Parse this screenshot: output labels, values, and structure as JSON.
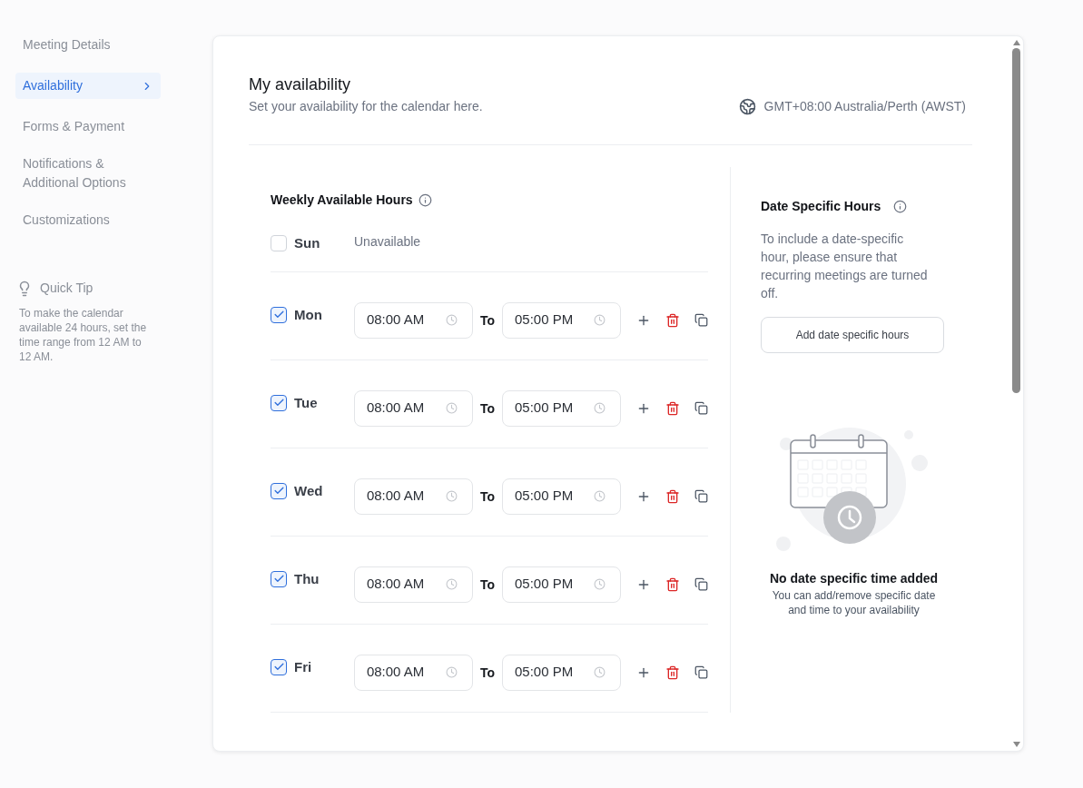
{
  "sidebar": {
    "items": [
      {
        "label": "Meeting Details",
        "selected": false
      },
      {
        "label": "Availability",
        "selected": true
      },
      {
        "label": "Forms & Payment",
        "selected": false
      },
      {
        "label": "Notifications & Additional Options",
        "selected": false
      },
      {
        "label": "Customizations",
        "selected": false
      }
    ],
    "tip": {
      "title": "Quick Tip",
      "text": "To make the calendar available 24 hours, set the time range from 12 AM to 12 AM."
    }
  },
  "header": {
    "title": "My availability",
    "subtitle": "Set your availability for the calendar here.",
    "timezone": "GMT+08:00 Australia/Perth (AWST)"
  },
  "weekly": {
    "title": "Weekly Available Hours",
    "days": [
      {
        "day": "Sun",
        "checked": false,
        "unavailable_label": "Unavailable"
      },
      {
        "day": "Mon",
        "checked": true,
        "start": "08:00 AM",
        "to_label": "To",
        "end": "05:00 PM"
      },
      {
        "day": "Tue",
        "checked": true,
        "start": "08:00 AM",
        "to_label": "To",
        "end": "05:00 PM"
      },
      {
        "day": "Wed",
        "checked": true,
        "start": "08:00 AM",
        "to_label": "To",
        "end": "05:00 PM"
      },
      {
        "day": "Thu",
        "checked": true,
        "start": "08:00 AM",
        "to_label": "To",
        "end": "05:00 PM"
      },
      {
        "day": "Fri",
        "checked": true,
        "start": "08:00 AM",
        "to_label": "To",
        "end": "05:00 PM"
      }
    ]
  },
  "date_specific": {
    "title": "Date Specific Hours",
    "text": "To include a date-specific hour, please ensure that recurring meetings are turned off.",
    "button": "Add date specific hours",
    "empty_title": "No date specific time added",
    "empty_text": "You can add/remove specific date and time to your availability"
  }
}
